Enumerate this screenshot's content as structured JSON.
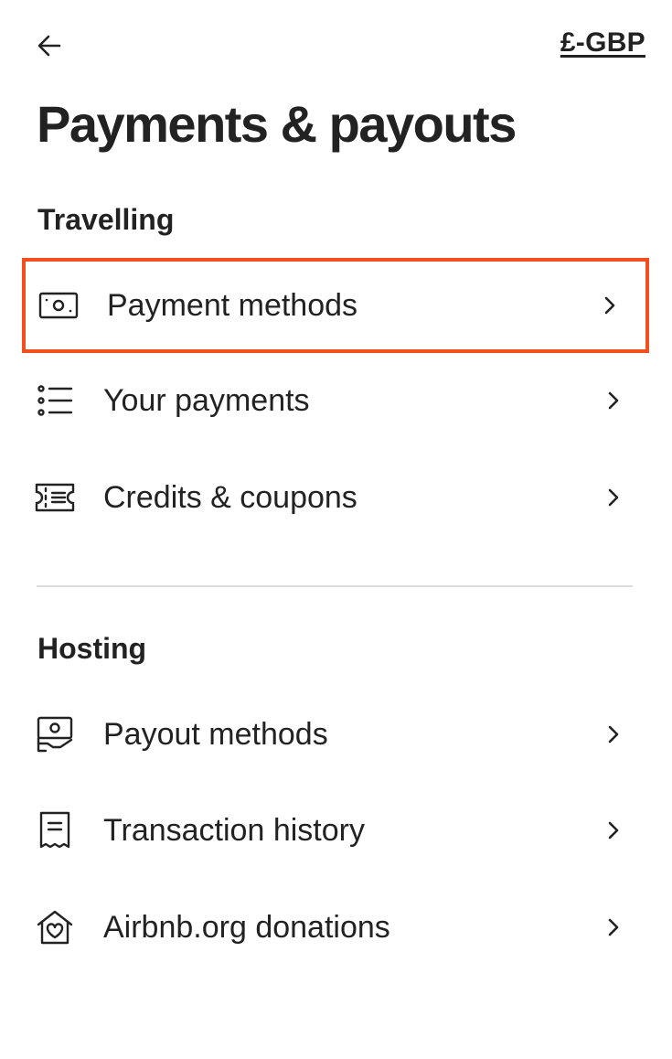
{
  "header": {
    "back_icon": "arrow-left-icon",
    "currency": "£-GBP"
  },
  "page": {
    "title": "Payments & payouts"
  },
  "sections": [
    {
      "heading": "Travelling",
      "items": [
        {
          "label": "Payment methods",
          "icon": "banknote-icon",
          "highlighted": true
        },
        {
          "label": "Your payments",
          "icon": "list-icon"
        },
        {
          "label": "Credits & coupons",
          "icon": "ticket-icon"
        }
      ]
    },
    {
      "heading": "Hosting",
      "items": [
        {
          "label": "Payout methods",
          "icon": "hand-money-icon"
        },
        {
          "label": "Transaction history",
          "icon": "receipt-icon"
        },
        {
          "label": "Airbnb.org donations",
          "icon": "heart-house-icon"
        }
      ]
    }
  ],
  "colors": {
    "text": "#222222",
    "highlight_border": "#f24e1e",
    "divider": "#dddddd"
  }
}
